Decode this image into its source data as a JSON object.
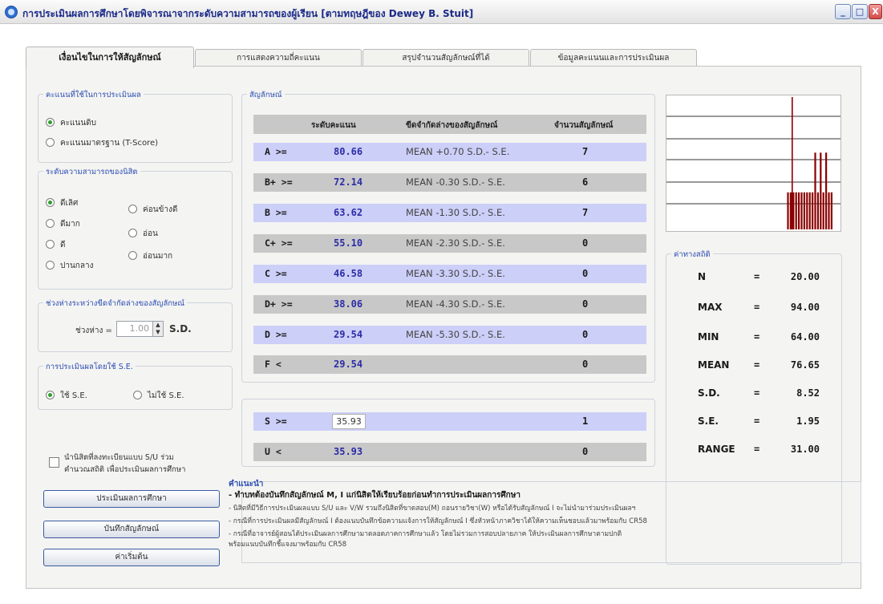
{
  "window": {
    "title": "การประเมินผลการศึกษาโดยพิจารณาจากระดับความสามารถของผู้เรียน [ตามทฤษฎีของ Dewey B. Stuit]",
    "min_label": "_",
    "max_label": "□",
    "close_label": "X"
  },
  "tabs": [
    {
      "label": "เงื่อนไขในการให้สัญลักษณ์"
    },
    {
      "label": "การแสดงความถี่คะแนน"
    },
    {
      "label": "สรุปจำนวนสัญลักษณ์ที่ได้"
    },
    {
      "label": "ข้อมูลคะแนนและการประเมินผล"
    }
  ],
  "score_group": {
    "legend": "คะแนนที่ใช้ในการประเมินผล",
    "options": [
      "คะแนนดิบ",
      "คะแนนมาตรฐาน (T-Score)"
    ]
  },
  "ability_group": {
    "legend": "ระดับความสามารถของนิสิต",
    "options": [
      "ดีเลิศ",
      "ดีมาก",
      "ดี",
      "ปานกลาง",
      "ค่อนข้างดี",
      "อ่อน",
      "อ่อนมาก"
    ]
  },
  "interval_group": {
    "legend": "ช่วงห่างระหว่างขีดจำกัดล่างของสัญลักษณ์",
    "label": "ช่วงห่าง =",
    "value": "1.00",
    "unit": "S.D."
  },
  "se_group": {
    "legend": "การประเมินผลโดยใช้ S.E.",
    "options": [
      "ใช้ S.E.",
      "ไม่ใช้ S.E."
    ]
  },
  "su_checkbox_label": [
    "นำนิสิตที่ลงทะเบียนแบบ S/U ร่วม",
    "คำนวณสถิติ เพื่อประเมินผลการศึกษา"
  ],
  "buttons": {
    "evaluate": "ประเมินผลการศึกษา",
    "save": "บันทึกสัญลักษณ์",
    "reset": "ค่าเริ่มต้น"
  },
  "grades": {
    "legend": "สัญลักษณ์",
    "headers": [
      "ระดับคะแนน",
      "ขีดจำกัดล่างของสัญลักษณ์",
      "จำนวนสัญลักษณ์"
    ],
    "rows": [
      {
        "grade": "A  >=",
        "score": "80.66",
        "criterion": "MEAN +0.70 S.D.- S.E.",
        "count": "7"
      },
      {
        "grade": "B+ >=",
        "score": "72.14",
        "criterion": "MEAN -0.30 S.D.- S.E.",
        "count": "6"
      },
      {
        "grade": "B  >=",
        "score": "63.62",
        "criterion": "MEAN -1.30 S.D.- S.E.",
        "count": "7"
      },
      {
        "grade": "C+ >=",
        "score": "55.10",
        "criterion": "MEAN -2.30 S.D.- S.E.",
        "count": "0"
      },
      {
        "grade": "C  >=",
        "score": "46.58",
        "criterion": "MEAN -3.30 S.D.- S.E.",
        "count": "0"
      },
      {
        "grade": "D+ >=",
        "score": "38.06",
        "criterion": "MEAN -4.30 S.D.- S.E.",
        "count": "0"
      },
      {
        "grade": "D  >=",
        "score": "29.54",
        "criterion": "MEAN -5.30 S.D.- S.E.",
        "count": "0"
      },
      {
        "grade": "F  <",
        "score": "29.54",
        "criterion": "",
        "count": "0"
      }
    ],
    "su_rows": [
      {
        "grade": "S  >=",
        "score": "35.93",
        "count": "1"
      },
      {
        "grade": "U  <",
        "score": "35.93",
        "count": "0"
      }
    ]
  },
  "histogram": {
    "bar_color": "#8b0000",
    "values": [
      1.0,
      0.28,
      0.28,
      0.28,
      0.28,
      0.28,
      0.28,
      0.28,
      0.28,
      0.28,
      0.28,
      0.58,
      0.28,
      0.58,
      0.28,
      0.58,
      0.28,
      0.28
    ]
  },
  "stats": {
    "legend": "ค่าทางสถิติ",
    "rows": [
      {
        "name": "N",
        "eq": "=",
        "value": "20.00"
      },
      {
        "name": "MAX",
        "eq": "=",
        "value": "94.00"
      },
      {
        "name": "MIN",
        "eq": "=",
        "value": "64.00"
      },
      {
        "name": "MEAN",
        "eq": "=",
        "value": "76.65"
      },
      {
        "name": "S.D.",
        "eq": "=",
        "value": "8.52"
      },
      {
        "name": "S.E.",
        "eq": "=",
        "value": "1.95"
      },
      {
        "name": "RANGE",
        "eq": "=",
        "value": "31.00"
      }
    ]
  },
  "notes": {
    "legend": "คำแนะนำ",
    "headline": "- ทำบทต้องบันทึกสัญลักษณ์ M, I แก่นิสิตให้เรียบร้อยก่อนทำการประเมินผลการศึกษา",
    "lines": [
      "- นิสิตที่มีวิธีการประเมินผลแบบ S/U และ V/W รวมถึงนิสิตที่ขาดสอบ(M) ถอนรายวิชา(W) หรือได้รับสัญลักษณ์ I จะไม่นำมาร่วมประเมินผลฯ",
      "- กรณีที่การประเมินผลมีสัญลักษณ์ I ต้องแนบบันทึกข้อความแจ้งการให้สัญลักษณ์ I ซึ่งหัวหน้าภาควิชาได้ให้ความเห็นชอบแล้วมาพร้อมกับ CR58",
      "- กรณีที่อาจารย์ผู้สอนได้ประเมินผลการศึกษามาตลอดภาคการศึกษาแล้ว โดยไม่รวมการสอบปลายภาค ให้ประเมินผลการศึกษาตามปกติ",
      "พร้อมแนบบันทึกชี้แจงมาพร้อมกับ CR58"
    ]
  }
}
